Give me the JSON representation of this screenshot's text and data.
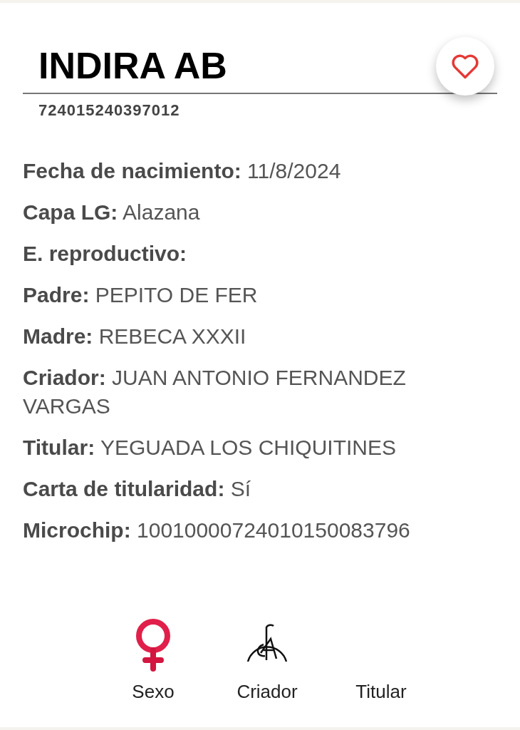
{
  "horse": {
    "name": "INDIRA AB",
    "code": "724015240397012",
    "favorite": false
  },
  "fields": [
    "**Fecha de nacimiento:** 11/8/2024",
    "**Capa LG:** Alazana",
    "**E. reproductivo:**",
    "**Padre:** PEPITO DE FER",
    "**Madre:** REBECA XXXII",
    "**Criador:** JUAN ANTONIO FERNANDEZ VARGAS",
    "**Titular:** YEGUADA LOS CHIQUITINES",
    "**Carta de titularidad:** Sí",
    "**Microchip:** 10010000724010150083796"
  ],
  "badges": [
    {
      "kind": "female",
      "label": "Sexo"
    },
    {
      "kind": "brand",
      "label": "Criador"
    },
    {
      "kind": "none",
      "label": "Titular"
    }
  ]
}
